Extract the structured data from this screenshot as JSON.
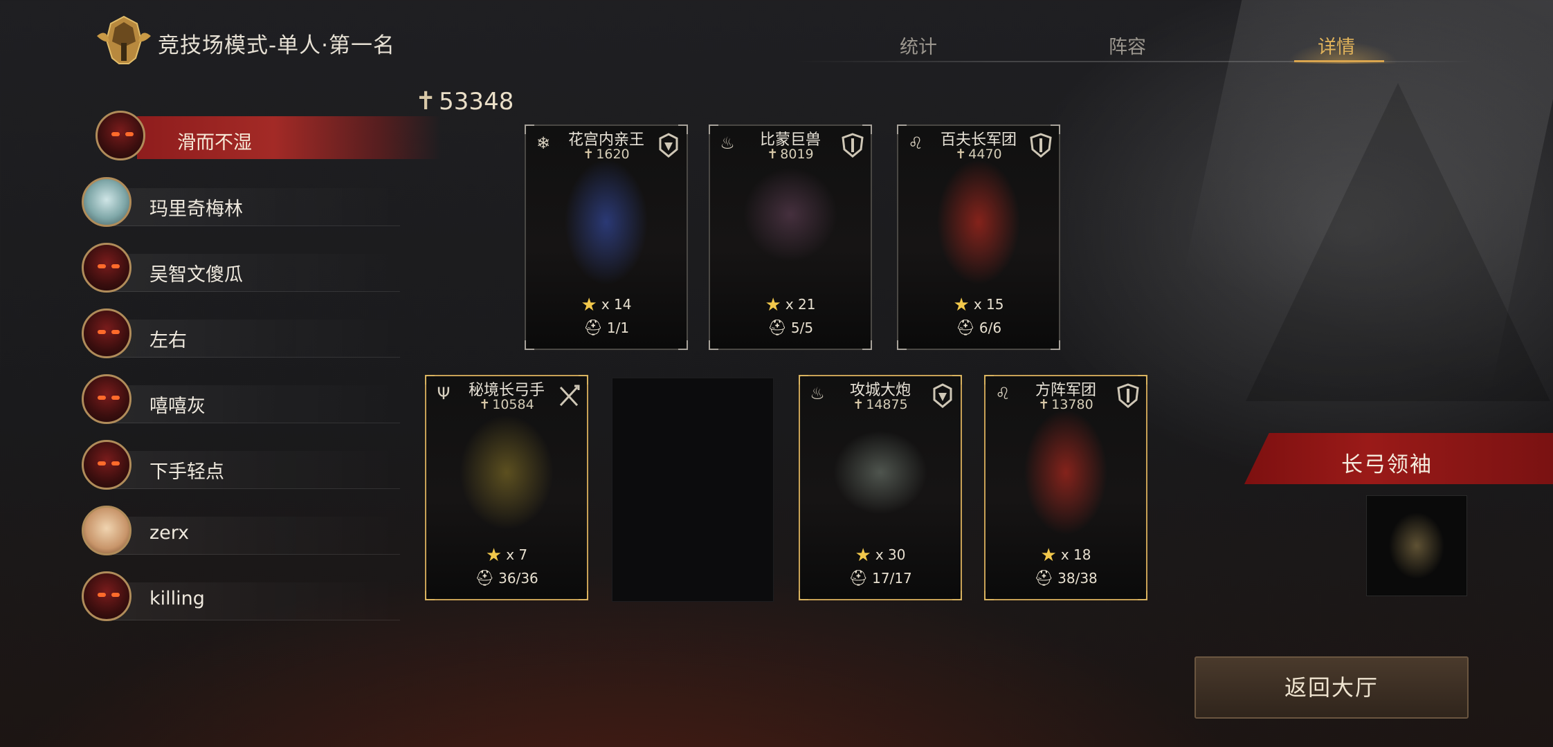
{
  "header": {
    "title": "竞技场模式-单人·第一名",
    "tabs": [
      "统计",
      "阵容",
      "详情"
    ],
    "active_tab": "详情"
  },
  "players": [
    {
      "name": "滑而不湿",
      "avatar": "demon-mask",
      "selected": true
    },
    {
      "name": "玛里奇梅林",
      "avatar": "photo"
    },
    {
      "name": "吴智文傻瓜",
      "avatar": "demon-mask"
    },
    {
      "name": "左右",
      "avatar": "demon-mask"
    },
    {
      "name": "嘻嘻灰",
      "avatar": "demon-mask"
    },
    {
      "name": "下手轻点",
      "avatar": "demon-mask"
    },
    {
      "name": "zerx",
      "avatar": "puppet"
    },
    {
      "name": "killing",
      "avatar": "demon-mask"
    }
  ],
  "power_total": "53348",
  "cards_row1": [
    {
      "name": "花宫内亲王",
      "power": "1620",
      "stars": "x 14",
      "units": "1/1",
      "faction_icon": "snowflake-icon",
      "class_icon": "helmet-crest-icon"
    },
    {
      "name": "比蒙巨兽",
      "power": "8019",
      "stars": "x 21",
      "units": "5/5",
      "faction_icon": "flame-icon",
      "class_icon": "shield-icon"
    },
    {
      "name": "百夫长军团",
      "power": "4470",
      "stars": "x 15",
      "units": "6/6",
      "faction_icon": "lion-icon",
      "class_icon": "shield-icon"
    }
  ],
  "cards_row2": [
    {
      "name": "秘境长弓手",
      "power": "10584",
      "stars": "x 7",
      "units": "36/36",
      "faction_icon": "antlers-icon",
      "class_icon": "crossed-arrows-icon"
    },
    {
      "name": "攻城大炮",
      "power": "14875",
      "stars": "x 30",
      "units": "17/17",
      "faction_icon": "flame-icon",
      "class_icon": "helmet-crest-icon"
    },
    {
      "name": "方阵军团",
      "power": "13780",
      "stars": "x 18",
      "units": "38/38",
      "faction_icon": "lion-icon",
      "class_icon": "shield-icon"
    }
  ],
  "leader": {
    "title": "长弓领袖"
  },
  "return_button": "返回大厅",
  "colors": {
    "accent_gold": "#d9a54f",
    "selected_red": "#a32a26",
    "star": "#f2c84b"
  }
}
